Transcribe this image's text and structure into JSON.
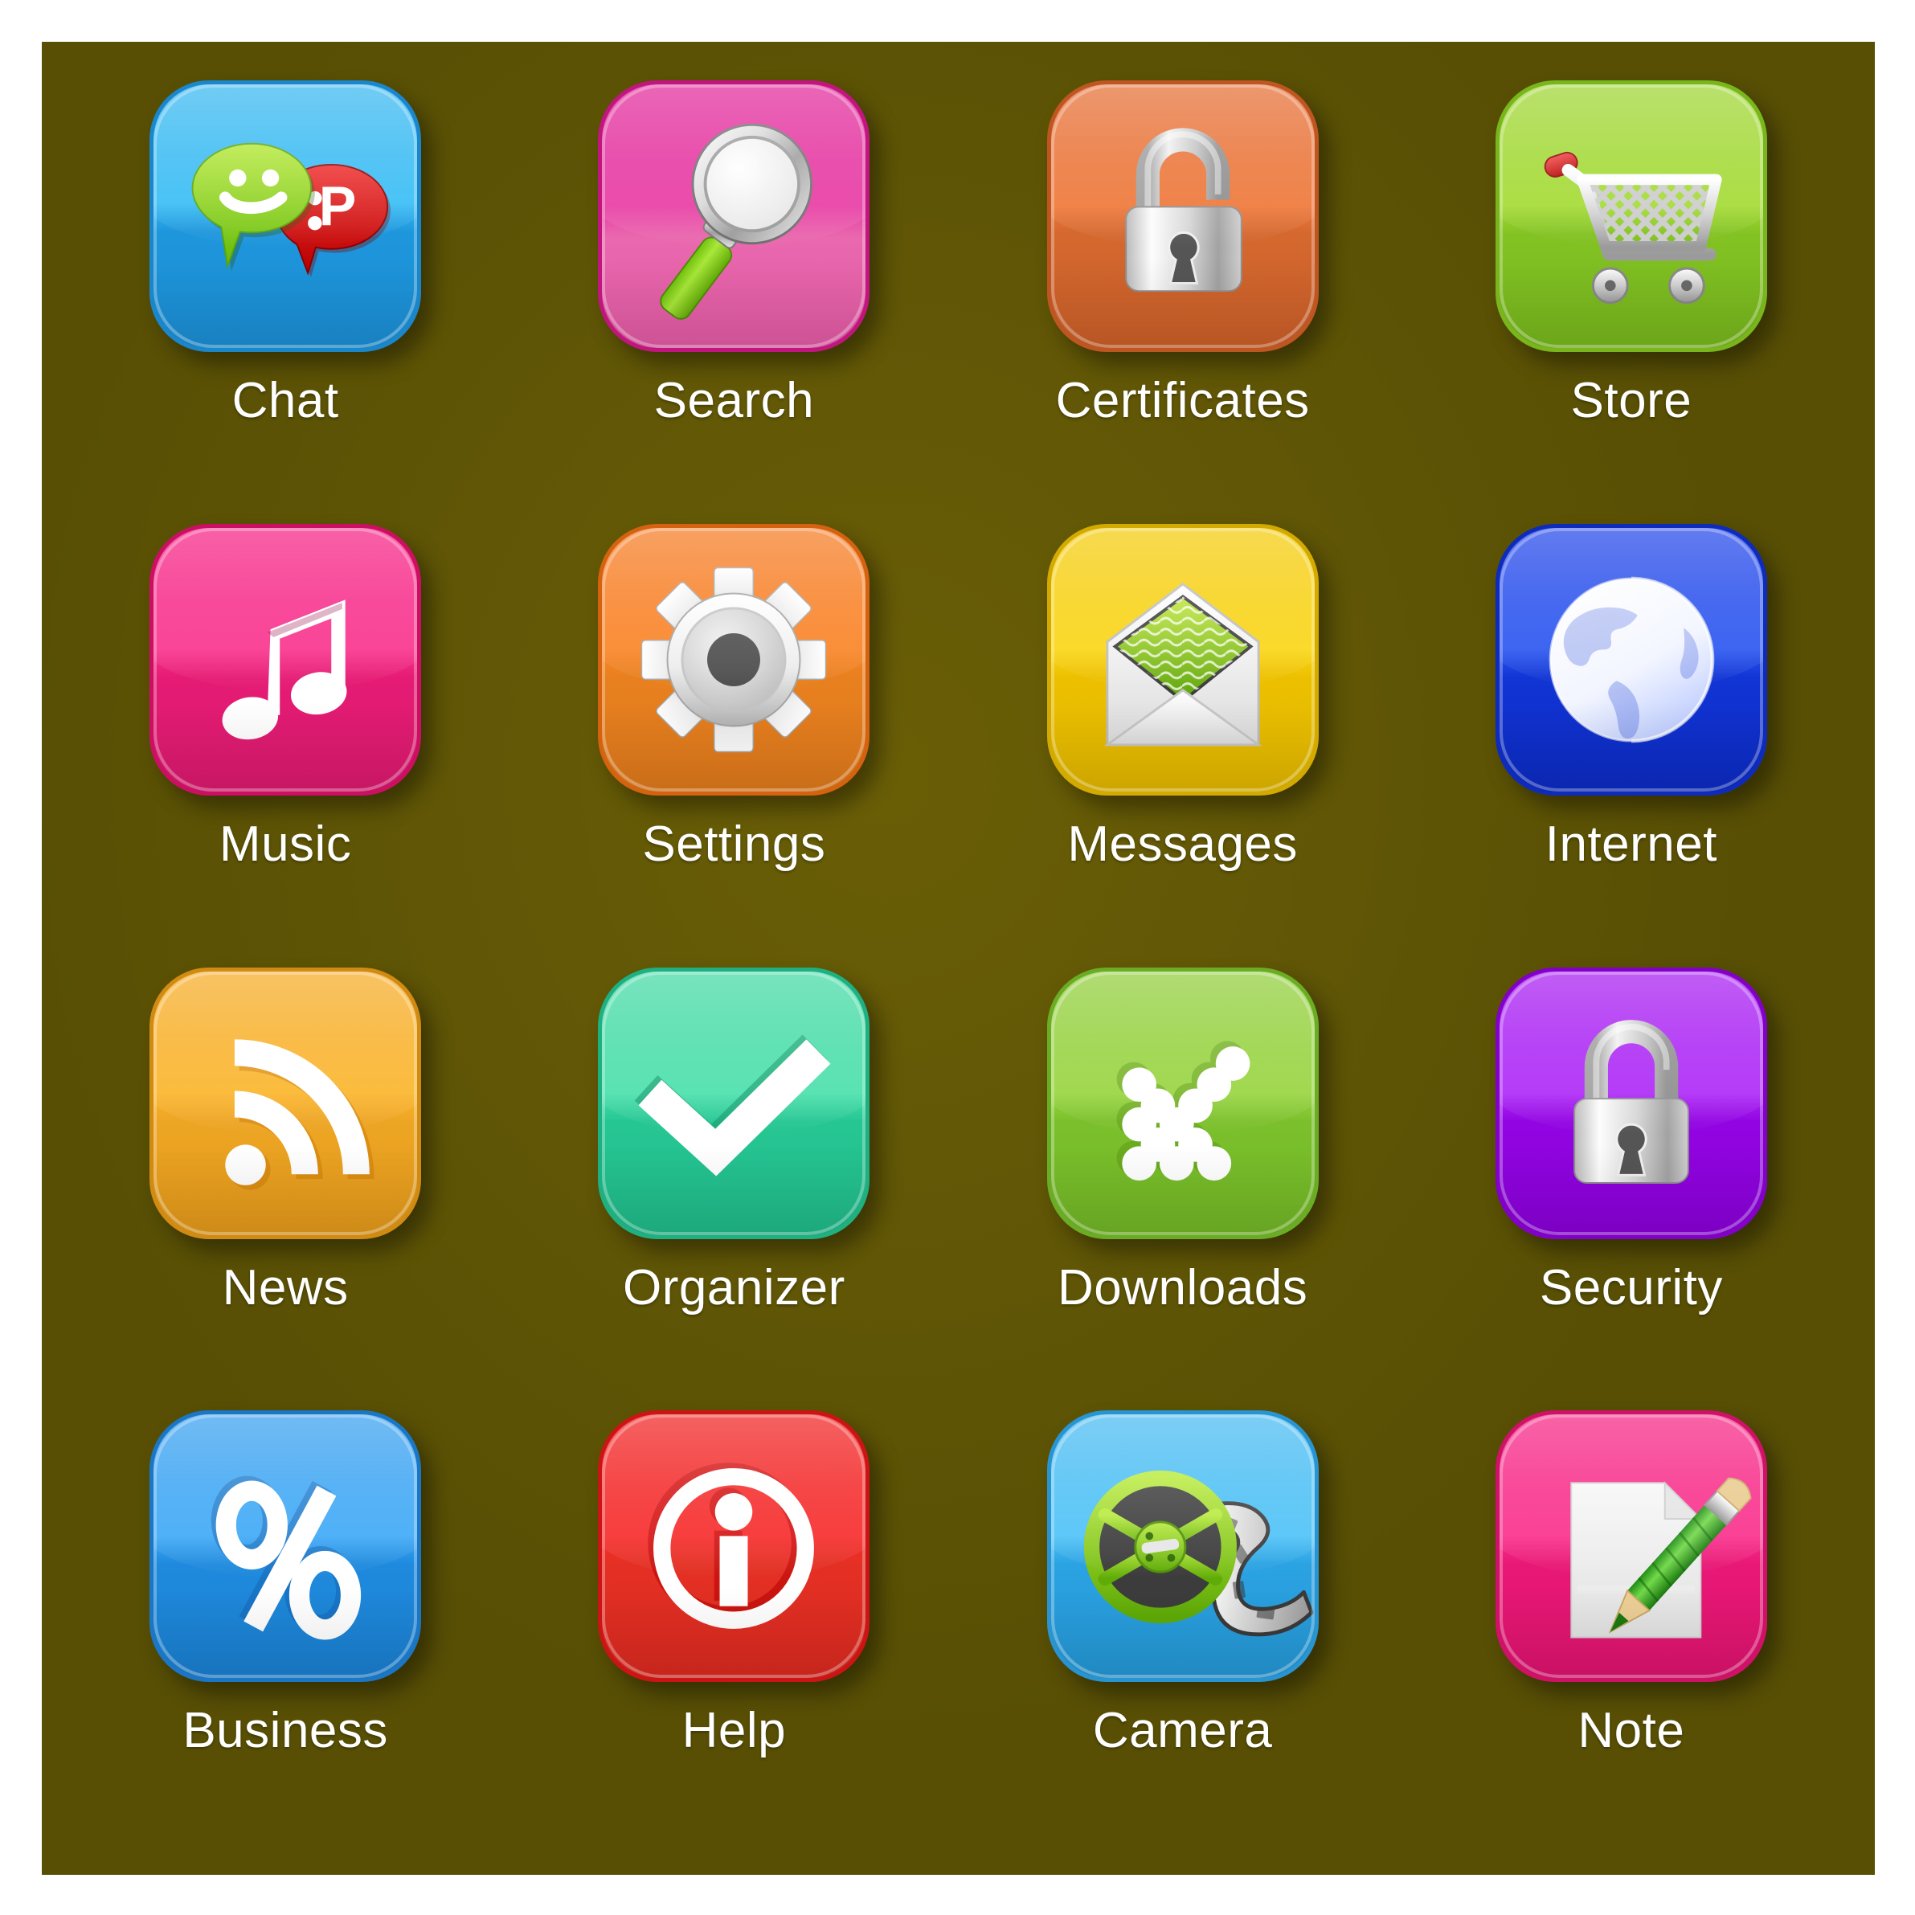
{
  "screen": {
    "background_color": "#584f05",
    "frame_color": "#ffffff",
    "grid": {
      "columns": 4,
      "rows": 4,
      "total_icons": 16
    }
  },
  "icons": [
    {
      "label": "Chat",
      "icon_name": "chat-bubbles-icon",
      "tile_color_top": "#2fb4ef",
      "tile_color_bottom": "#1b8fd6",
      "border_color": "#1a86cc"
    },
    {
      "label": "Search",
      "icon_name": "magnifier-icon",
      "tile_color_top": "#e01f96",
      "tile_color_bottom": "#ea5aa8",
      "border_color": "#c2157f"
    },
    {
      "label": "Certificates",
      "icon_name": "open-padlock-icon",
      "tile_color_top": "#e4672b",
      "tile_color_bottom": "#d4682f",
      "border_color": "#bf5622"
    },
    {
      "label": "Store",
      "icon_name": "shopping-cart-icon",
      "tile_color_top": "#9ad329",
      "tile_color_bottom": "#7cbb1f",
      "border_color": "#78b61c"
    },
    {
      "label": "Music",
      "icon_name": "music-note-icon",
      "tile_color_top": "#f5177f",
      "tile_color_bottom": "#e51b74",
      "border_color": "#cc0f63"
    },
    {
      "label": "Settings",
      "icon_name": "gear-icon",
      "tile_color_top": "#f5751a",
      "tile_color_bottom": "#e8801f",
      "border_color": "#d4620f"
    },
    {
      "label": "Messages",
      "icon_name": "envelope-icon",
      "tile_color_top": "#f3c800",
      "tile_color_bottom": "#ecc000",
      "border_color": "#d2aa00"
    },
    {
      "label": "Internet",
      "icon_name": "globe-icon",
      "tile_color_top": "#1a3ee8",
      "tile_color_bottom": "#1031d0",
      "border_color": "#0e2bbb"
    },
    {
      "label": "News",
      "icon_name": "rss-feed-icon",
      "tile_color_top": "#f5a71c",
      "tile_color_bottom": "#e8a32a",
      "border_color": "#d18b12"
    },
    {
      "label": "Organizer",
      "icon_name": "checkmark-icon",
      "tile_color_top": "#3ad7a0",
      "tile_color_bottom": "#24c391",
      "border_color": "#1fb082"
    },
    {
      "label": "Downloads",
      "icon_name": "dotted-arrow-icon",
      "tile_color_top": "#8ccb33",
      "tile_color_bottom": "#74bb2c",
      "border_color": "#6aad24"
    },
    {
      "label": "Security",
      "icon_name": "closed-padlock-icon",
      "tile_color_top": "#a313f0",
      "tile_color_bottom": "#9102e0",
      "border_color": "#8200c8"
    },
    {
      "label": "Business",
      "icon_name": "percent-icon",
      "tile_color_top": "#2f9bee",
      "tile_color_bottom": "#1f85dd",
      "border_color": "#1b76c6"
    },
    {
      "label": "Help",
      "icon_name": "info-circle-icon",
      "tile_color_top": "#f01818",
      "tile_color_bottom": "#e23024",
      "border_color": "#cc1414"
    },
    {
      "label": "Camera",
      "icon_name": "film-reel-icon",
      "tile_color_top": "#3fb7f0",
      "tile_color_bottom": "#2fa4e4",
      "border_color": "#2894d2"
    },
    {
      "label": "Note",
      "icon_name": "note-pencil-icon",
      "tile_color_top": "#f51b7f",
      "tile_color_bottom": "#e81876",
      "border_color": "#cf1167"
    }
  ],
  "palette": {
    "silver_light": "#f2f2f2",
    "silver_mid": "#c9c9c9",
    "silver_dark": "#8e8e8e",
    "white": "#ffffff",
    "keyhole_dark": "#555555",
    "accent_green": "#8cd119",
    "accent_red": "#d40000"
  }
}
